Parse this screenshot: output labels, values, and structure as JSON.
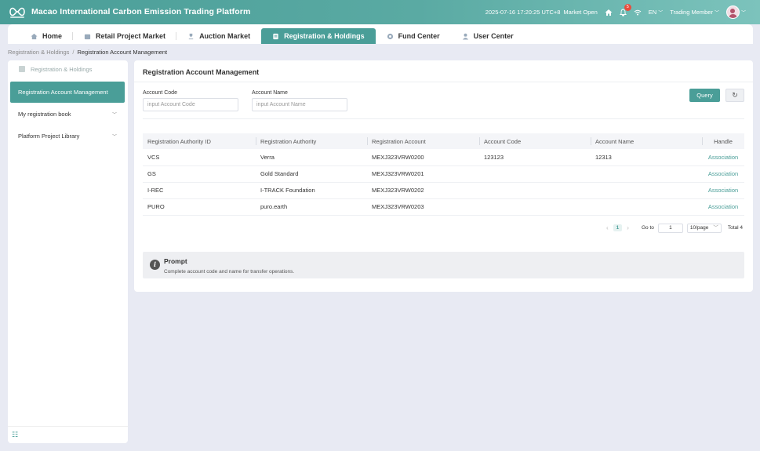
{
  "header": {
    "app_title": "Macao International Carbon Emission Trading Platform",
    "datetime": "2025-07-16 17:20:25 UTC+8",
    "market_status": "Market Open",
    "notification_count": "5",
    "language": "EN",
    "user_role": "Trading Member"
  },
  "tabs": [
    {
      "label": "Home",
      "icon": "home-icon"
    },
    {
      "label": "Retail Project Market",
      "icon": "store-icon"
    },
    {
      "label": "Auction Market",
      "icon": "gavel-icon"
    },
    {
      "label": "Registration & Holdings",
      "icon": "registry-icon"
    },
    {
      "label": "Fund Center",
      "icon": "fund-icon"
    },
    {
      "label": "User Center",
      "icon": "user-icon"
    }
  ],
  "breadcrumb": {
    "parent": "Registration & Holdings",
    "current": "Registration Account Management"
  },
  "sidebar": {
    "section": "Registration & Holdings",
    "active_item": "Registration Account Management",
    "items": [
      {
        "label": "My registration book"
      },
      {
        "label": "Platform Project Library"
      }
    ]
  },
  "main": {
    "title": "Registration Account Management",
    "filters": {
      "account_code_label": "Account Code",
      "account_code_placeholder": "input Account Code",
      "account_name_label": "Account Name",
      "account_name_placeholder": "input Account Name"
    },
    "query_label": "Query",
    "table": {
      "columns": [
        "Registration Authority ID",
        "Registration Authority",
        "Registration Account",
        "Account Code",
        "Account Name",
        "Handle"
      ],
      "rows": [
        [
          "VCS",
          "Verra",
          "MEXJ323VRW0200",
          "123123",
          "12313",
          "Association"
        ],
        [
          "GS",
          "Gold Standard",
          "MEXJ323VRW0201",
          "",
          "",
          "Association"
        ],
        [
          "I-REC",
          "I-TRACK Foundation",
          "MEXJ323VRW0202",
          "",
          "",
          "Association"
        ],
        [
          "PURO",
          "puro.earth",
          "MEXJ323VRW0203",
          "",
          "",
          "Association"
        ]
      ]
    },
    "pagination": {
      "current_page": "1",
      "goto_label": "Go to",
      "goto_value": "1",
      "page_size": "10/page",
      "total": "Total 4"
    },
    "prompt": {
      "title": "Prompt",
      "text": "Complete account code and name for transfer operations."
    }
  },
  "colors": {
    "accent": "#4a9e98",
    "badge": "#e84c3d",
    "background": "#e8eaf3"
  }
}
